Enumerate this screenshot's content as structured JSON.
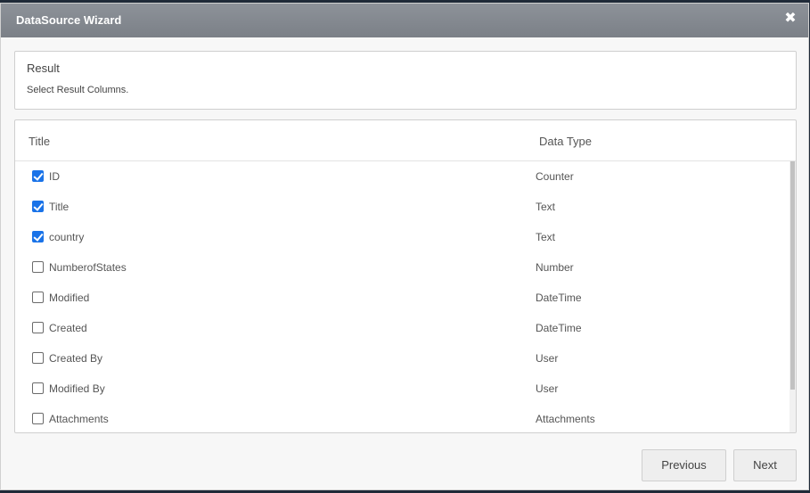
{
  "dialog": {
    "title": "DataSource Wizard",
    "close_icon": "close-icon"
  },
  "result": {
    "heading": "Result",
    "description": "Select Result Columns."
  },
  "table": {
    "headers": {
      "title": "Title",
      "data_type": "Data Type"
    },
    "rows": [
      {
        "name": "ID",
        "type": "Counter",
        "checked": true
      },
      {
        "name": "Title",
        "type": "Text",
        "checked": true
      },
      {
        "name": "country",
        "type": "Text",
        "checked": true
      },
      {
        "name": "NumberofStates",
        "type": "Number",
        "checked": false
      },
      {
        "name": "Modified",
        "type": "DateTime",
        "checked": false
      },
      {
        "name": "Created",
        "type": "DateTime",
        "checked": false
      },
      {
        "name": "Created By",
        "type": "User",
        "checked": false
      },
      {
        "name": "Modified By",
        "type": "User",
        "checked": false
      },
      {
        "name": "Attachments",
        "type": "Attachments",
        "checked": false
      }
    ]
  },
  "buttons": {
    "previous": "Previous",
    "next": "Next"
  },
  "colors": {
    "titlebar": "#7f848b",
    "checkbox_checked": "#1a73e8"
  }
}
